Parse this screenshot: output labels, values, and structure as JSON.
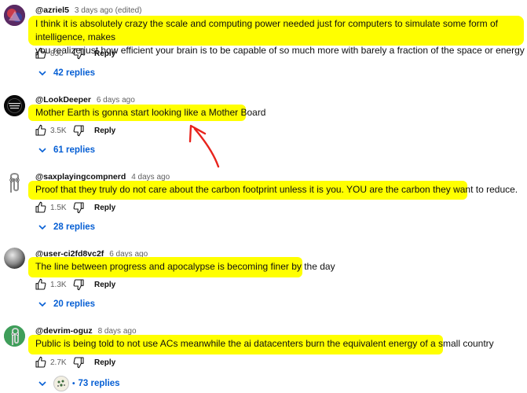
{
  "comments": [
    {
      "username": "@azriel5",
      "time": "3 days ago (edited)",
      "text_lines": [
        "I think it is absolutely crazy the scale and computing power needed just for computers to simulate some form of intelligence, makes",
        "you realize just how efficient your brain is to be capable of so much more with barely a fraction of the space or energy"
      ],
      "likes": "830",
      "reply_label": "Reply",
      "replies": "42 replies"
    },
    {
      "username": "@LookDeeper",
      "time": "6 days ago",
      "text_lines": [
        "Mother Earth is gonna start looking like a Mother Board"
      ],
      "likes": "3.5K",
      "reply_label": "Reply",
      "replies": "61 replies",
      "avatar_text": "LOOK DEEPER"
    },
    {
      "username": "@saxplayingcompnerd",
      "time": "4 days ago",
      "text_lines": [
        "Proof that they truly do not care about the carbon footprint unless it is you. YOU are the carbon they want to reduce."
      ],
      "likes": "1.5K",
      "reply_label": "Reply",
      "replies": "28 replies"
    },
    {
      "username": "@user-ci2fd8vc2f",
      "time": "6 days ago",
      "text_lines": [
        "The line between progress and apocalypse is becoming finer by the day"
      ],
      "likes": "1.3K",
      "reply_label": "Reply",
      "replies": "20 replies"
    },
    {
      "username": "@devrim-oguz",
      "time": "8 days ago",
      "text_lines": [
        "Public is being told to not use ACs meanwhile the ai datacenters burn the equivalent energy of a small country"
      ],
      "likes": "2.7K",
      "reply_label": "Reply",
      "replies": "73 replies",
      "dot": "•"
    }
  ],
  "colors": {
    "highlight": "#ffff00",
    "link_blue": "#065fd4",
    "annotation_arrow": "#e8231c"
  },
  "icons": {
    "like": "thumbs-up-icon",
    "dislike": "thumbs-down-icon",
    "expand": "chevron-down-icon",
    "annotation": "red-arrow-annotation"
  }
}
